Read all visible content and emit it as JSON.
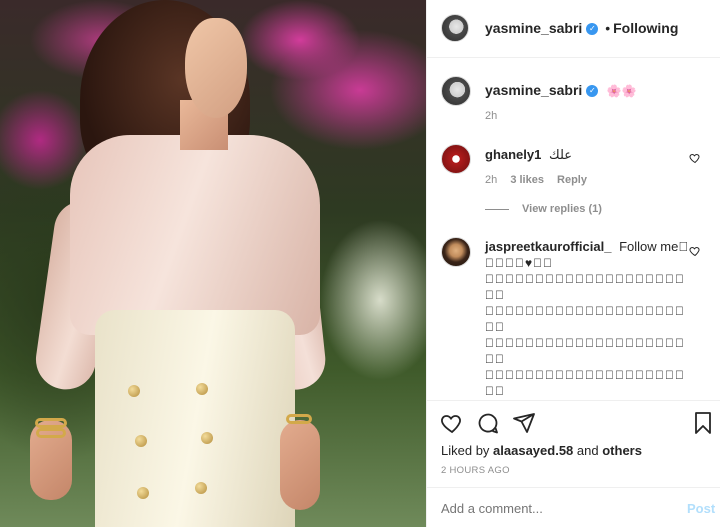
{
  "post": {
    "author": "yasmine_sabri",
    "follow_status": "Following",
    "separator": "•"
  },
  "caption": {
    "author": "yasmine_sabri",
    "text": "🌸🌸",
    "time": "2h"
  },
  "comments": [
    {
      "author": "ghanely1",
      "text": "علك",
      "time": "2h",
      "likes": "3 likes",
      "reply_label": "Reply",
      "view_replies": "View replies (1)"
    },
    {
      "author": "jaspreetkaurofficial_",
      "text": "Follow me􏿾",
      "lines": [
        "􏿾􏿾􏿾􏿾♥􏿾􏿾",
        "􏿾􏿾􏿾􏿾􏿾􏿾􏿾􏿾􏿾􏿾􏿾􏿾􏿾􏿾􏿾􏿾􏿾􏿾􏿾􏿾",
        "􏿾􏿾",
        "􏿾􏿾􏿾􏿾􏿾􏿾􏿾􏿾􏿾􏿾􏿾􏿾􏿾􏿾􏿾􏿾􏿾􏿾􏿾􏿾",
        "􏿾􏿾",
        "􏿾􏿾􏿾􏿾􏿾􏿾􏿾􏿾􏿾􏿾􏿾􏿾􏿾􏿾􏿾􏿾􏿾􏿾􏿾􏿾",
        "􏿾􏿾",
        "􏿾􏿾􏿾􏿾􏿾􏿾􏿾􏿾􏿾􏿾􏿾􏿾􏿾􏿾􏿾􏿾􏿾􏿾􏿾􏿾",
        "􏿾􏿾"
      ]
    }
  ],
  "likes": {
    "prefix": "Liked by",
    "user": "alaasayed.58",
    "and": "and",
    "others": "others"
  },
  "timestamp": "2 HOURS AGO",
  "add_comment": {
    "placeholder": "Add a comment...",
    "post_label": "Post"
  },
  "colors": {
    "link_blue": "#3897f0",
    "post_disabled": "#b2dffc",
    "meta_gray": "#8e8e8e"
  }
}
